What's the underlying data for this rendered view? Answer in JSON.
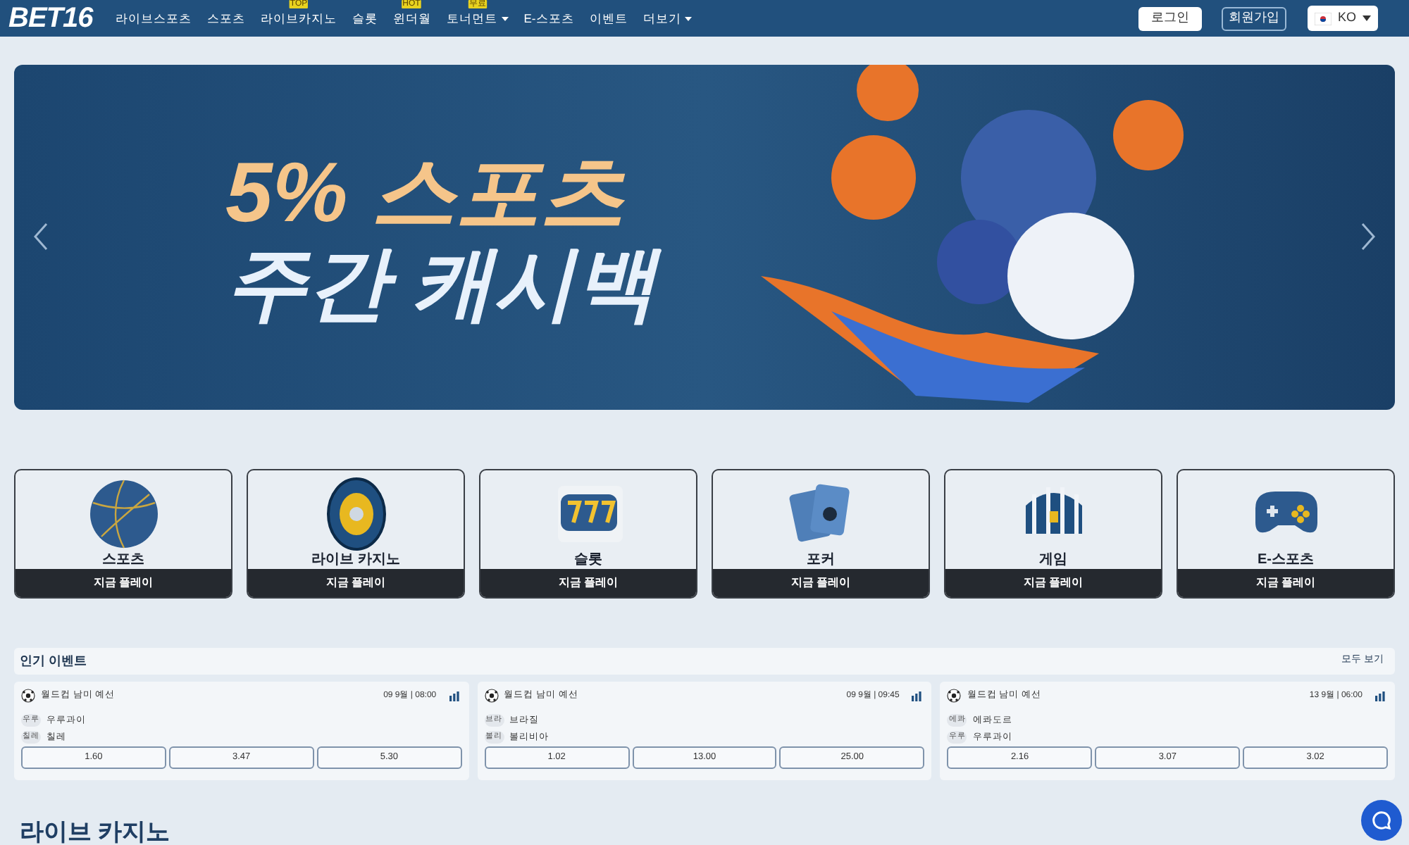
{
  "header": {
    "logo": "BET16",
    "nav": [
      {
        "label": "라이브스포츠",
        "dropdown": false
      },
      {
        "label": "스포츠",
        "dropdown": false
      },
      {
        "label": "라이브카지노",
        "badge": "TOP",
        "dropdown": false
      },
      {
        "label": "슬롯",
        "dropdown": false
      },
      {
        "label": "윈더월",
        "badge": "HOT",
        "dropdown": false
      },
      {
        "label": "토너먼트",
        "badge": "무료",
        "dropdown": true
      },
      {
        "label": "E-스포츠",
        "dropdown": false
      },
      {
        "label": "이벤트",
        "dropdown": false
      },
      {
        "label": "더보기",
        "dropdown": true
      }
    ],
    "login": "로그인",
    "signup": "회원가입",
    "language": "KO"
  },
  "banner": {
    "line_1": "5% 스포츠",
    "line_2": "주간 캐시백"
  },
  "categories": [
    {
      "kind": "sports",
      "label": "스포츠",
      "cta": "지금 플레이"
    },
    {
      "kind": "casino",
      "label": "라이브 카지노",
      "cta": "지금 플레이"
    },
    {
      "kind": "slots",
      "label": "슬롯",
      "cta": "지금 플레이"
    },
    {
      "kind": "poker",
      "label": "포커",
      "cta": "지금 플레이"
    },
    {
      "kind": "games",
      "label": "게임",
      "cta": "지금 플레이"
    },
    {
      "kind": "esports",
      "label": "E-스포츠",
      "cta": "지금 플레이"
    }
  ],
  "popular_events": {
    "title": "인기 이벤트",
    "see_all": "모두 보기",
    "events": [
      {
        "league": "월드컵 남미 예선",
        "time": "09 9월 | 08:00",
        "teams": [
          {
            "abbr": "우루",
            "name": "우루과이"
          },
          {
            "abbr": "칠레",
            "name": "칠레"
          }
        ],
        "odds": [
          "1.60",
          "3.47",
          "5.30"
        ]
      },
      {
        "league": "월드컵 남미 예선",
        "time": "09 9월 | 09:45",
        "teams": [
          {
            "abbr": "브라",
            "name": "브라질"
          },
          {
            "abbr": "볼리",
            "name": "볼리비아"
          }
        ],
        "odds": [
          "1.02",
          "13.00",
          "25.00"
        ]
      },
      {
        "league": "월드컵 남미 예선",
        "time": "13 9월 | 06:00",
        "teams": [
          {
            "abbr": "에콰",
            "name": "에콰도르"
          },
          {
            "abbr": "우루",
            "name": "우루과이"
          }
        ],
        "odds": [
          "2.16",
          "3.07",
          "3.02"
        ]
      }
    ]
  },
  "live_casino": {
    "title": "라이브 카지노"
  }
}
